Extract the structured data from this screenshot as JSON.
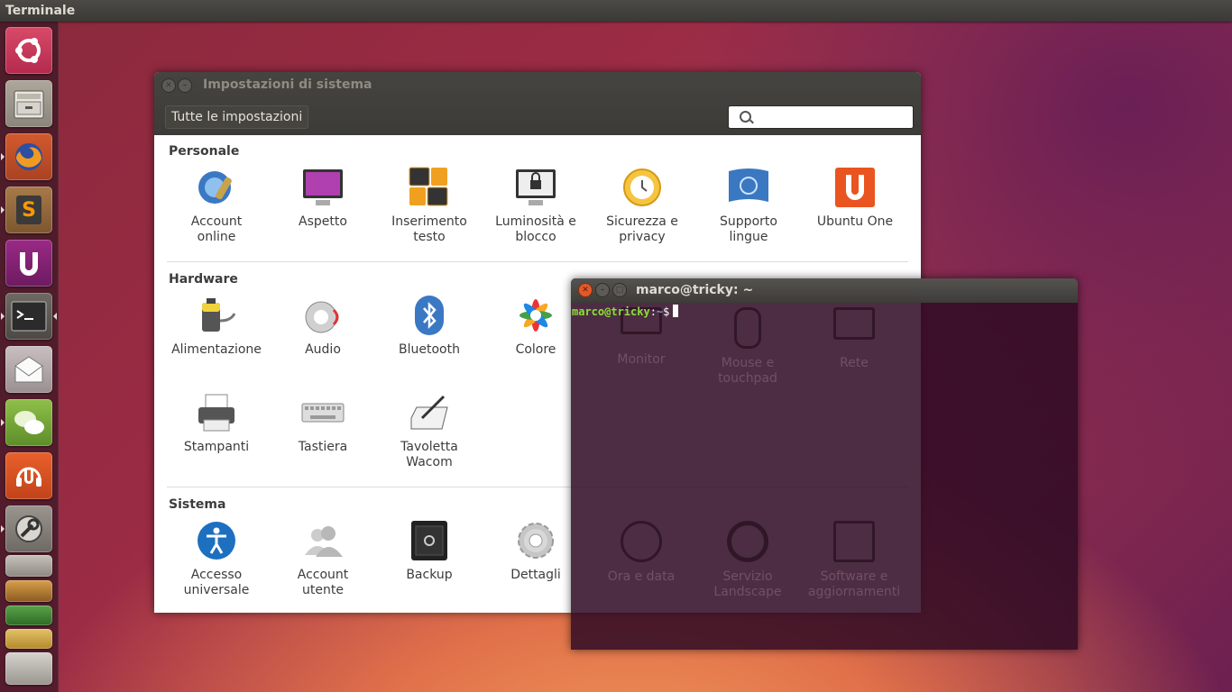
{
  "top_panel": {
    "title": "Terminale"
  },
  "launcher": {
    "items": [
      "ubuntu-dash",
      "file-manager",
      "firefox",
      "sublime-text",
      "ubuntu-software",
      "terminal",
      "mail",
      "empathy",
      "ubuntu-one-music",
      "system-tools",
      "workspace-switcher",
      "app-stack"
    ]
  },
  "settings": {
    "title": "Impostazioni di sistema",
    "all_settings_label": "Tutte le impostazioni",
    "search_placeholder": "",
    "sections": {
      "personale": {
        "title": "Personale",
        "items": [
          {
            "label": "Account\nonline"
          },
          {
            "label": "Aspetto"
          },
          {
            "label": "Inserimento\ntesto"
          },
          {
            "label": "Luminosità e\nblocco"
          },
          {
            "label": "Sicurezza e\nprivacy"
          },
          {
            "label": "Supporto\nlingue"
          },
          {
            "label": "Ubuntu One"
          }
        ]
      },
      "hardware": {
        "title": "Hardware",
        "items": [
          {
            "label": "Alimentazione"
          },
          {
            "label": "Audio"
          },
          {
            "label": "Bluetooth"
          },
          {
            "label": "Colore"
          },
          {
            "label": "Monitor"
          },
          {
            "label": "Mouse e\ntouchpad"
          },
          {
            "label": "Rete"
          },
          {
            "label": "Stampanti"
          },
          {
            "label": "Tastiera"
          },
          {
            "label": "Tavoletta\nWacom"
          }
        ]
      },
      "sistema": {
        "title": "Sistema",
        "items": [
          {
            "label": "Accesso\nuniversale"
          },
          {
            "label": "Account\nutente"
          },
          {
            "label": "Backup"
          },
          {
            "label": "Dettagli"
          },
          {
            "label": "Ora e data"
          },
          {
            "label": "Servizio\nLandscape"
          },
          {
            "label": "Software e\naggiornamenti"
          }
        ]
      }
    }
  },
  "terminal": {
    "title": "marco@tricky: ~",
    "prompt_user": "marco@tricky",
    "prompt_sep": ":",
    "prompt_path": "~",
    "prompt_symbol": "$"
  },
  "colors": {
    "terminal_bg": "#300a24",
    "prompt_user": "#8ae234",
    "prompt_path": "#729fcf"
  }
}
